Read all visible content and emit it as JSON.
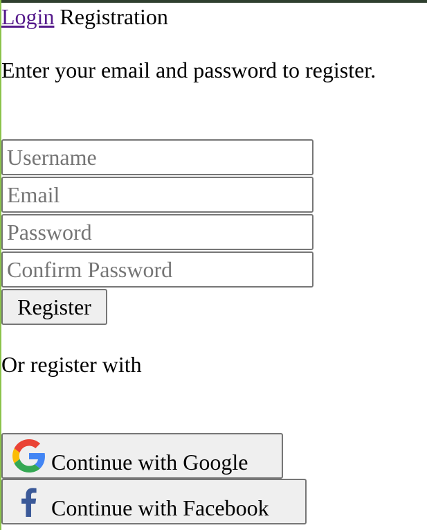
{
  "header": {
    "login_link": "Login",
    "title": "Registration"
  },
  "intro": "Enter your email and password to register.",
  "form": {
    "username_placeholder": "Username",
    "email_placeholder": "Email",
    "password_placeholder": "Password",
    "confirm_placeholder": "Confirm Password",
    "register_label": "Register"
  },
  "social": {
    "or_text": "Or register with",
    "google_label": "Continue with Google",
    "google_icon": "google-g-icon",
    "facebook_label": "Continue with Facebook",
    "facebook_icon": "facebook-f-icon"
  },
  "colors": {
    "link": "#551a8b",
    "left_accent": "#8bc34a",
    "top_bar": "#2f3f2f",
    "button_bg": "#efefef",
    "facebook_blue": "#3b5998"
  }
}
